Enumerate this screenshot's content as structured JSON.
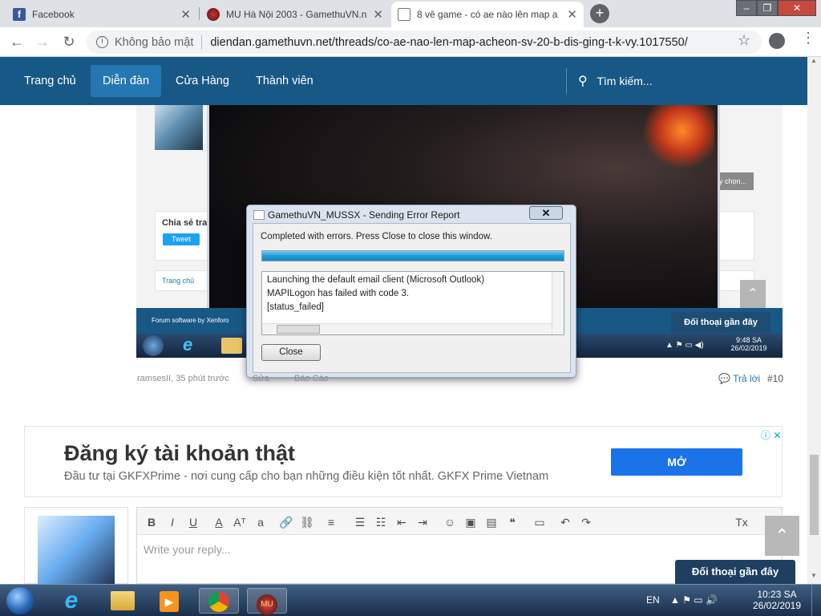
{
  "browser": {
    "tabs": [
      {
        "label": "Facebook",
        "active": false
      },
      {
        "label": "MU Hà Nội 2003 - GamethuVN.n",
        "active": false
      },
      {
        "label": "8 vê game - có ae nào lên map a",
        "active": true
      }
    ],
    "security_label": "Không bảo mật",
    "url": "diendan.gamethuvn.net/threads/co-ae-nao-len-map-acheon-sv-20-b-dis-ging-t-k-vy.1017550/"
  },
  "forum_nav": {
    "items": [
      "Trang chủ",
      "Diễn đàn",
      "Cửa Hàng",
      "Thành viên"
    ],
    "search_label": "Tìm kiếm..."
  },
  "screenshot": {
    "dialog_title": "GamethuVN_MUSSX - Sending Error Report",
    "status_text": "Completed with errors. Press Close to close this window.",
    "log_lines": [
      "Launching the default email client (Microsoft Outlook)",
      "MAPILogon has failed with code 3.",
      "[status_failed]"
    ],
    "close_label": "Close",
    "share_label": "Chia sẻ tra",
    "tweet_label": "Tweet",
    "breadcrumb": "Trang chủ",
    "options_label": "y chọn...",
    "footer_left": "Forum software by Xenforo",
    "footer_right": "Đối thoại gần đây",
    "clock_time": "9:48 SA",
    "clock_date": "26/02/2019"
  },
  "post_meta": {
    "author_time": "ramsesII, 35 phút trước",
    "edit_label": "Sửa",
    "report_label": "Báo Cáo",
    "reply_label": "Trả lời",
    "post_number": "#10"
  },
  "ad": {
    "title": "Đăng ký tài khoản thật",
    "subtitle": "Đầu tư tại GKFXPrime - nơi cung cấp cho bạn những điều kiện tốt nhất. GKFX Prime Vietnam",
    "button": "MỞ"
  },
  "editor": {
    "placeholder": "Write your reply..."
  },
  "chat_bubble": "Đối thoại gần đây",
  "taskbar": {
    "lang": "EN",
    "time": "10:23 SA",
    "date": "26/02/2019"
  },
  "colors": {
    "nav": "#185886",
    "nav_selected": "#2577b1",
    "ad_button": "#1a73e8"
  }
}
